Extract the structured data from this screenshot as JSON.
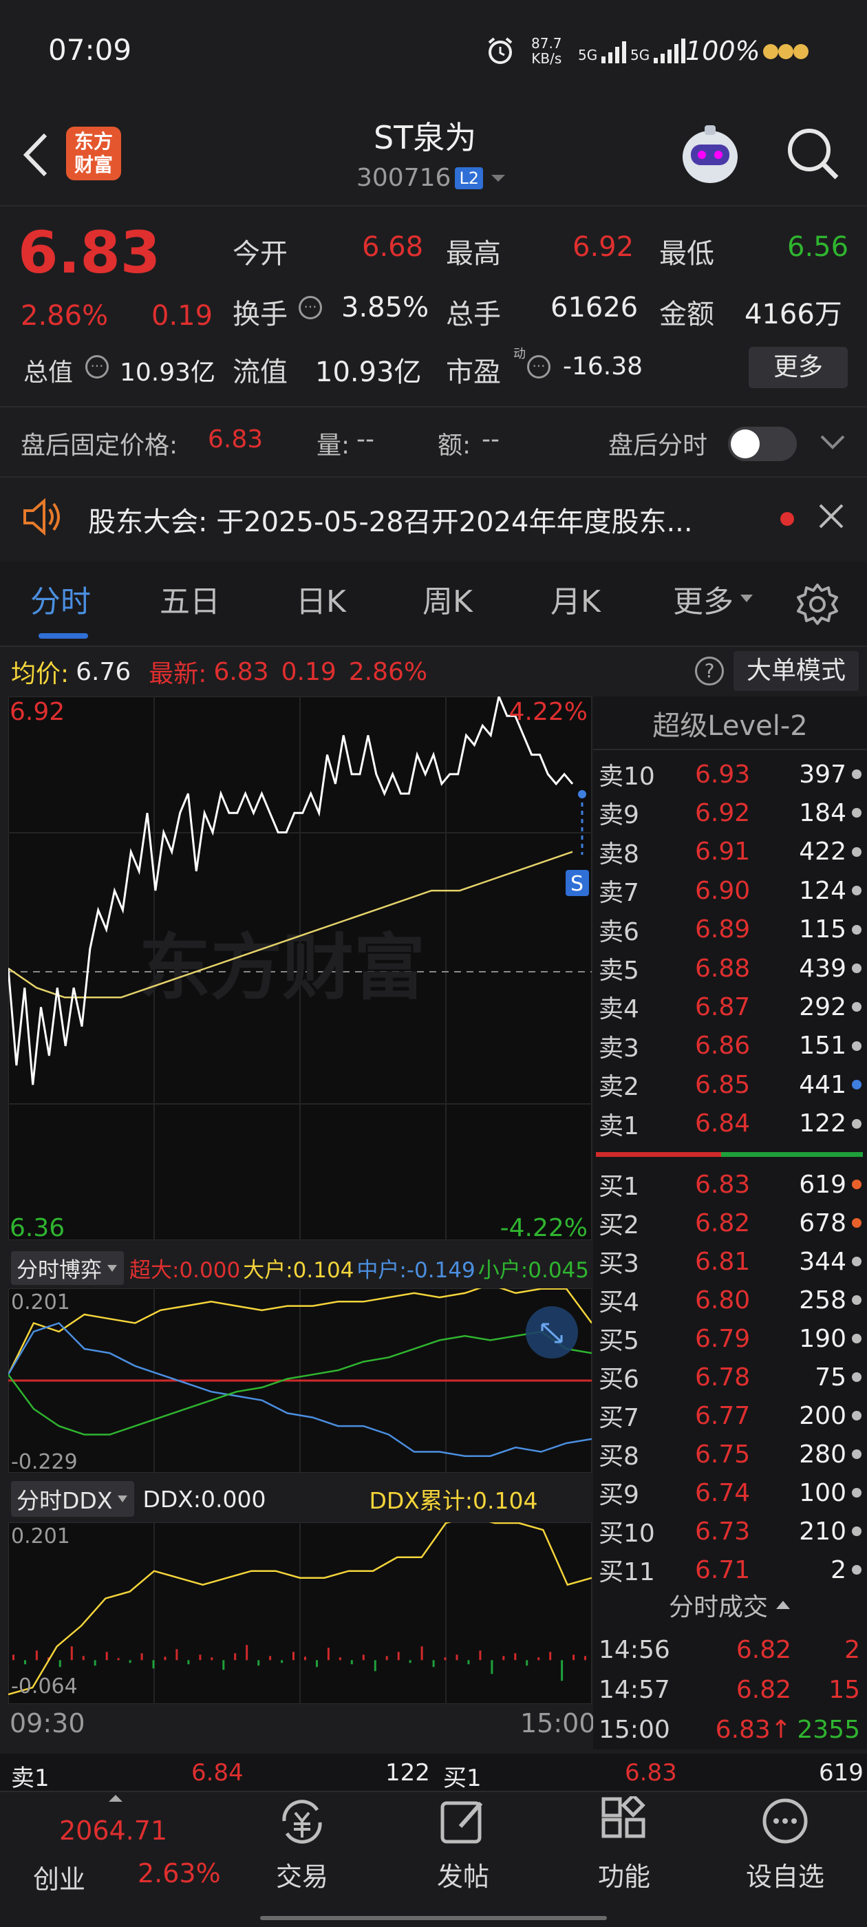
{
  "status_bar": {
    "time": "07:09",
    "net_speed": "87.7",
    "net_unit": "KB/s",
    "sig1": "5G",
    "sig2": "5G",
    "battery": "100%"
  },
  "header": {
    "brand_top": "东方",
    "brand_bottom": "财富",
    "stock_name": "ST泉为",
    "stock_code": "300716",
    "level_badge": "L2"
  },
  "quote": {
    "price": "6.83",
    "change_pct": "2.86%",
    "change": "0.19",
    "open_label": "今开",
    "open": "6.68",
    "high_label": "最高",
    "high": "6.92",
    "low_label": "最低",
    "low": "6.56",
    "turnover_label": "换手",
    "turnover": "3.85%",
    "volume_label": "总手",
    "volume": "61626",
    "amount_label": "金额",
    "amount": "4166万",
    "mktcap_label": "总值",
    "mktcap": "10.93亿",
    "float_label": "流值",
    "float_cap": "10.93亿",
    "pe_label": "市盈",
    "pe_sup": "动",
    "pe": "-16.38",
    "more_label": "更多"
  },
  "after_hours": {
    "fixed_label": "盘后固定价格:",
    "fixed_price": "6.83",
    "vol_label": "量:",
    "vol": "--",
    "amt_label": "额:",
    "amt": "--",
    "timeshare_label": "盘后分时"
  },
  "notice": {
    "text": "股东大会:  于2025-05-28召开2024年年度股东..."
  },
  "tabs": [
    "分时",
    "五日",
    "日K",
    "周K",
    "月K",
    "更多"
  ],
  "chart_header": {
    "avg_label": "均价:",
    "avg": "6.76",
    "latest_label": "最新:",
    "latest": "6.83",
    "change": "0.19",
    "change_pct": "2.86%",
    "big_order_btn": "大单模式"
  },
  "chart_labels": {
    "price_top": "6.92",
    "pct_top": "4.22%",
    "price_bottom": "6.36",
    "pct_bottom": "-4.22%",
    "watermark": "东方财富",
    "s_marker": "S",
    "sub1_selector": "分时博弈",
    "sub1_super": "超大:0.000",
    "sub1_large": "大户:0.104",
    "sub1_mid": "中户:-0.149",
    "sub1_small": "小户:0.045",
    "sub1_top": "0.201",
    "sub1_bottom": "-0.229",
    "sub2_selector": "分时DDX",
    "sub2_ddx": "DDX:0.000",
    "sub2_cum": "DDX累计:0.104",
    "sub2_top": "0.201",
    "sub2_bottom": "-0.064",
    "time_start": "09:30",
    "time_end": "15:00"
  },
  "chart_data": {
    "type": "line",
    "title": "",
    "ylim": [
      6.36,
      6.92
    ],
    "prev_close": 6.64,
    "series": [
      {
        "values": [
          6.64,
          6.54,
          6.62,
          6.52,
          6.6,
          6.55,
          6.62,
          6.56,
          6.62,
          6.58,
          6.66,
          6.7,
          6.68,
          6.72,
          6.7,
          6.76,
          6.74,
          6.8,
          6.72,
          6.78,
          6.76,
          6.8,
          6.82,
          6.74,
          6.8,
          6.78,
          6.82,
          6.8,
          6.8,
          6.82,
          6.8,
          6.82,
          6.8,
          6.78,
          6.78,
          6.8,
          6.8,
          6.82,
          6.8,
          6.86,
          6.83,
          6.88,
          6.84,
          6.84,
          6.88,
          6.84,
          6.82,
          6.84,
          6.82,
          6.82,
          6.86,
          6.84,
          6.86,
          6.83,
          6.84,
          6.84,
          6.88,
          6.87,
          6.89,
          6.88,
          6.92,
          6.9,
          6.9,
          6.88,
          6.86,
          6.86,
          6.84,
          6.83,
          6.84,
          6.83
        ]
      },
      {
        "values": [
          6.64,
          6.62,
          6.61,
          6.61,
          6.61,
          6.62,
          6.63,
          6.64,
          6.65,
          6.66,
          6.67,
          6.68,
          6.69,
          6.7,
          6.71,
          6.72,
          6.72,
          6.73,
          6.74,
          6.75,
          6.76
        ]
      }
    ]
  },
  "subchart_data": {
    "type": "line",
    "series": [
      {
        "values": [
          0.0,
          0.12,
          0.1,
          0.14,
          0.13,
          0.12,
          0.15,
          0.16,
          0.17,
          0.16,
          0.15,
          0.16,
          0.16,
          0.17,
          0.17,
          0.18,
          0.19,
          0.18,
          0.19,
          0.21,
          0.19,
          0.2,
          0.2,
          0.12
        ]
      },
      {
        "values": [
          0.0,
          0.1,
          0.12,
          0.06,
          0.05,
          0.02,
          0.0,
          -0.02,
          -0.04,
          -0.05,
          -0.06,
          -0.09,
          -0.1,
          -0.12,
          -0.12,
          -0.14,
          -0.18,
          -0.18,
          -0.19,
          -0.19,
          -0.17,
          -0.18,
          -0.16,
          -0.15
        ]
      },
      {
        "values": [
          0.0,
          -0.08,
          -0.12,
          -0.14,
          -0.14,
          -0.12,
          -0.1,
          -0.08,
          -0.06,
          -0.04,
          -0.03,
          -0.01,
          0.0,
          0.01,
          0.03,
          0.04,
          0.06,
          0.08,
          0.09,
          0.08,
          0.09,
          0.1,
          0.06,
          0.05
        ]
      }
    ]
  },
  "ddx_data": {
    "type": "line",
    "cum": [
      -0.05,
      -0.04,
      0.02,
      0.05,
      0.09,
      0.1,
      0.13,
      0.12,
      0.11,
      0.12,
      0.13,
      0.13,
      0.12,
      0.12,
      0.13,
      0.13,
      0.15,
      0.15,
      0.2,
      0.21,
      0.2,
      0.2,
      0.19,
      0.11,
      0.12
    ]
  },
  "level2": {
    "title": "超级Level-2",
    "sell": [
      {
        "label": "卖10",
        "price": "6.93",
        "vol": "397"
      },
      {
        "label": "卖9",
        "price": "6.92",
        "vol": "184"
      },
      {
        "label": "卖8",
        "price": "6.91",
        "vol": "422"
      },
      {
        "label": "卖7",
        "price": "6.90",
        "vol": "124"
      },
      {
        "label": "卖6",
        "price": "6.89",
        "vol": "115"
      },
      {
        "label": "卖5",
        "price": "6.88",
        "vol": "439"
      },
      {
        "label": "卖4",
        "price": "6.87",
        "vol": "292"
      },
      {
        "label": "卖3",
        "price": "6.86",
        "vol": "151"
      },
      {
        "label": "卖2",
        "price": "6.85",
        "vol": "441"
      },
      {
        "label": "卖1",
        "price": "6.84",
        "vol": "122"
      }
    ],
    "buy": [
      {
        "label": "买1",
        "price": "6.83",
        "vol": "619"
      },
      {
        "label": "买2",
        "price": "6.82",
        "vol": "678"
      },
      {
        "label": "买3",
        "price": "6.81",
        "vol": "344"
      },
      {
        "label": "买4",
        "price": "6.80",
        "vol": "258"
      },
      {
        "label": "买5",
        "price": "6.79",
        "vol": "190"
      },
      {
        "label": "买6",
        "price": "6.78",
        "vol": "75"
      },
      {
        "label": "买7",
        "price": "6.77",
        "vol": "200"
      },
      {
        "label": "买8",
        "price": "6.75",
        "vol": "280"
      },
      {
        "label": "买9",
        "price": "6.74",
        "vol": "100"
      },
      {
        "label": "买10",
        "price": "6.73",
        "vol": "210"
      },
      {
        "label": "买11",
        "price": "6.71",
        "vol": "2"
      }
    ],
    "buy_ratio": 0.47,
    "ticks_title": "分时成交",
    "ticks": [
      {
        "time": "14:56",
        "price": "6.82",
        "vol": "2"
      },
      {
        "time": "14:57",
        "price": "6.82",
        "vol": "15"
      },
      {
        "time": "15:00",
        "price": "6.83↑",
        "vol": "2355"
      }
    ]
  },
  "footer_quote": {
    "sell1_label": "卖1",
    "sell1_price": "6.84",
    "sell1_vol": "122",
    "buy1_label": "买1",
    "buy1_price": "6.83",
    "buy1_vol": "619"
  },
  "bottom_nav": {
    "index_value": "2064.71",
    "index_name": "创业",
    "index_pct": "2.63%",
    "trade": "交易",
    "post": "发帖",
    "func": "功能",
    "watchlist": "设自选"
  }
}
